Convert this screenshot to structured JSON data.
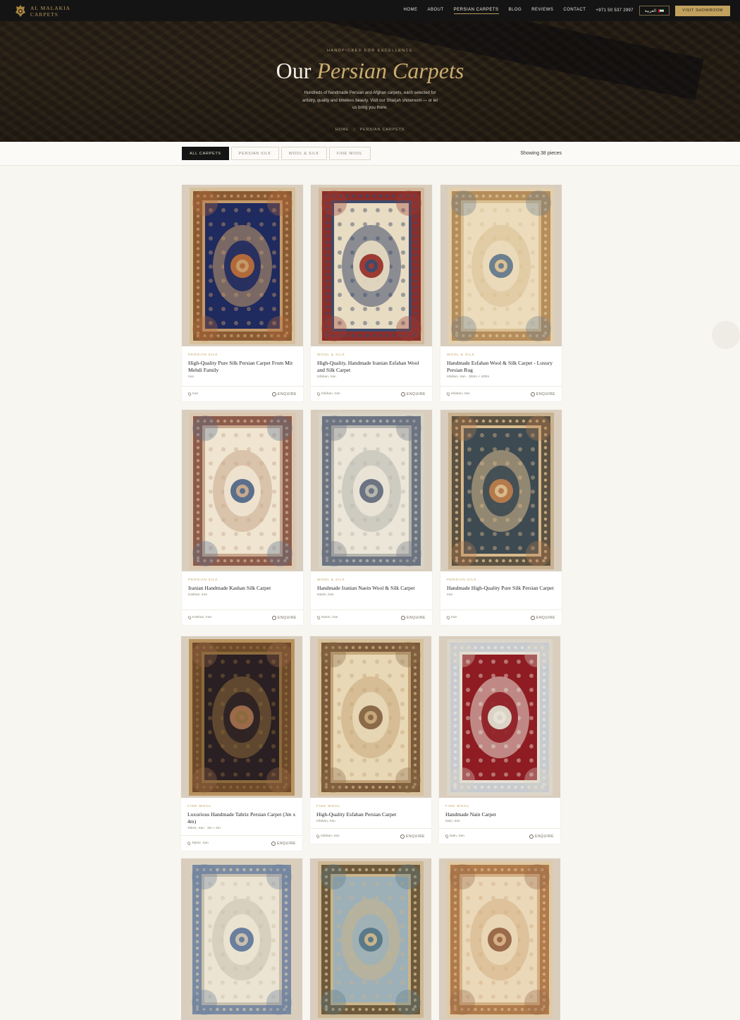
{
  "nav": {
    "logo_line1": "AL MALAKIA",
    "logo_line2": "CARPETS",
    "items": [
      {
        "label": "HOME"
      },
      {
        "label": "ABOUT"
      },
      {
        "label": "PERSIAN CARPETS",
        "active": true
      },
      {
        "label": "BLOG"
      },
      {
        "label": "REVIEWS"
      },
      {
        "label": "CONTACT"
      }
    ],
    "phone": "+971 50 537 2997",
    "lang_label": "العربية",
    "cta_label": "VISIT SHOWROOM"
  },
  "hero": {
    "eyebrow": "HANDPICKED FOR EXCELLENCE",
    "title_plain": "Our ",
    "title_accent": "Persian Carpets",
    "description": "Hundreds of handmade Persian and Afghan carpets, each selected for artistry, quality and timeless beauty. Visit our Sharjah showroom — or let us bring you there.",
    "breadcrumb_home": "HOME",
    "breadcrumb_sep": "/",
    "breadcrumb_current": "PERSIAN CARPETS"
  },
  "filters": {
    "chips": [
      {
        "label": "ALL CARPETS",
        "active": true
      },
      {
        "label": "PERSIAN SILK"
      },
      {
        "label": "WOOL & SILK"
      },
      {
        "label": "FINE WOOL"
      }
    ],
    "count_text": "Showing 38 pieces"
  },
  "colors": {
    "accent_gold": "#c1a15d",
    "nav_bg": "#141414",
    "page_bg": "#f8f6f1"
  },
  "cards": [
    {
      "category": "PERSIAN SILK",
      "name": "High-Quality Pure Silk Persian Carpet From Mir Mehdi Family",
      "origin": "Iran",
      "location": "Iran",
      "enquire": "ENQUIRE",
      "rug": {
        "field": "#1f2a5e",
        "border": "#8a5a33",
        "inner": "#c49a6a",
        "medallion": "#b26a3b",
        "edge": "#d7c09a"
      }
    },
    {
      "category": "WOOL & SILK",
      "name": "High-Quality, Handmade Iranian Esfahan Wool and Silk Carpet",
      "origin": "Isfahan, Iran",
      "location": "Isfahan, Iran",
      "enquire": "ENQUIRE",
      "rug": {
        "field": "#e8dcc2",
        "border": "#8b2e2a",
        "inner": "#3c4a6b",
        "medallion": "#9c3b34",
        "edge": "#d2b99a"
      }
    },
    {
      "category": "WOOL & SILK",
      "name": "Handmade Esfahan Wool & Silk Carpet - Luxury Persian Rug",
      "origin": "Isfahan, Iran · 300m × 400m",
      "location": "Isfahan, Iran",
      "enquire": "ENQUIRE",
      "rug": {
        "field": "#ecdcbc",
        "border": "#b58d5a",
        "inner": "#d9bf92",
        "medallion": "#6b7f8e",
        "edge": "#e2cfae"
      }
    },
    {
      "category": "PERSIAN SILK",
      "name": "Iranian Handmade Kashan Silk Carpet",
      "origin": "Kashan, Iran",
      "location": "Kashan, Iran",
      "enquire": "ENQUIRE",
      "rug": {
        "field": "#efe5d1",
        "border": "#8c5b4a",
        "inner": "#c8a88d",
        "medallion": "#5b6f8c",
        "edge": "#dcc6ae"
      }
    },
    {
      "category": "WOOL & SILK",
      "name": "Handmade Iranian Naein Wool & Silk Carpet",
      "origin": "Naein, Iran",
      "location": "Naein, Iran",
      "enquire": "ENQUIRE",
      "rug": {
        "field": "#ece6d8",
        "border": "#6c7482",
        "inner": "#b7b6ae",
        "medallion": "#6c7482",
        "edge": "#d9d3c6"
      }
    },
    {
      "category": "PERSIAN SILK",
      "name": "Handmade High-Quality Pure Silk Persian Carpet",
      "origin": "Iran",
      "location": "Iran",
      "enquire": "ENQUIRE",
      "rug": {
        "field": "#3d4a52",
        "border": "#5c5242",
        "inner": "#d8b98a",
        "medallion": "#b47a4c",
        "edge": "#c8b18e"
      }
    },
    {
      "category": "FINE WOOL",
      "name": "Luxurious Handmade Tabriz Persian Carpet (3m x 4m)",
      "origin": "Tabriz, Iran · 3m × 4m",
      "location": "Tabriz, Iran",
      "enquire": "ENQUIRE",
      "rug": {
        "field": "#2a1f22",
        "border": "#6e4a2a",
        "inner": "#8a6a3a",
        "medallion": "#9a6a4a",
        "edge": "#b9935e"
      }
    },
    {
      "category": "FINE WOOL",
      "name": "High-Quality Esfahan Persian Carpet",
      "origin": "Isfahan, Iran",
      "location": "Isfahan, Iran",
      "enquire": "ENQUIRE",
      "rug": {
        "field": "#e8d8b6",
        "border": "#7a5a3a",
        "inner": "#c6a77a",
        "medallion": "#8a6a48",
        "edge": "#d8c29c"
      }
    },
    {
      "category": "FINE WOOL",
      "name": "Handmade Nain Carpet",
      "origin": "Nain, Iran",
      "location": "Nain, Iran",
      "enquire": "ENQUIRE",
      "rug": {
        "field": "#8e1c22",
        "border": "#c7cbd0",
        "inner": "#e8e2d6",
        "medallion": "#d9d4c6",
        "edge": "#dcd6ca"
      }
    },
    {
      "category": "",
      "name": "",
      "origin": "",
      "location": "",
      "enquire": "",
      "rug": {
        "field": "#ece4d2",
        "border": "#7a8aa2",
        "inner": "#c9c0ad",
        "medallion": "#6a7f9e",
        "edge": "#d9ceba"
      }
    },
    {
      "category": "",
      "name": "",
      "origin": "",
      "location": "",
      "enquire": "",
      "rug": {
        "field": "#9db0b8",
        "border": "#6e5a3a",
        "inner": "#c9b48a",
        "medallion": "#5a7a8a",
        "edge": "#cdb894"
      }
    },
    {
      "category": "",
      "name": "",
      "origin": "",
      "location": "",
      "enquire": "",
      "rug": {
        "field": "#ead8b8",
        "border": "#b07a4a",
        "inner": "#d4b084",
        "medallion": "#9a6a4a",
        "edge": "#e0c9a4"
      }
    }
  ]
}
